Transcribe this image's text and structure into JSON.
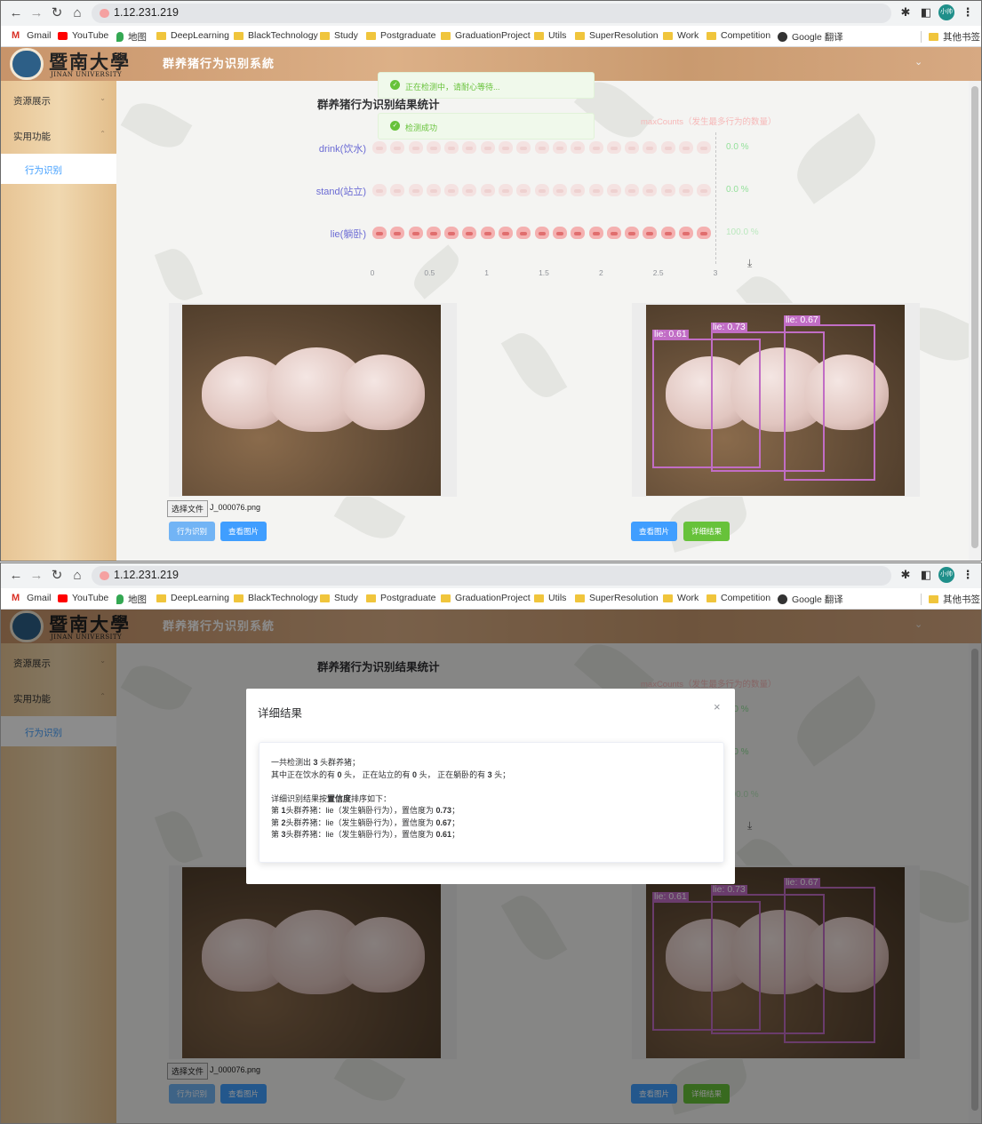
{
  "browser": {
    "url": "1.12.231.219",
    "avatar_text": "小帅",
    "bookmarks": [
      "Gmail",
      "YouTube",
      "地图",
      "DeepLearning",
      "BlackTechnology",
      "Study",
      "Postgraduate",
      "GraduationProject",
      "Utils",
      "SuperResolution",
      "Work",
      "Competition",
      "Google 翻译"
    ],
    "other_bookmarks": "其他书签"
  },
  "header": {
    "logo_cn": "暨南大學",
    "logo_en": "JINAN UNIVERSITY",
    "system_title": "群养猪行为识别系統"
  },
  "sidebar": {
    "items": [
      {
        "label": "资源展示"
      },
      {
        "label": "实用功能"
      },
      {
        "label": "行为识别"
      }
    ]
  },
  "notifications": {
    "detecting": "正在检测中，请耐心等待...",
    "success": "检测成功"
  },
  "chart_data": {
    "type": "pictorial-bar",
    "title": "群养猪行为识别结果统计",
    "legend": "maxCounts（发生最多行为的数量）",
    "categories": [
      "drink(饮水)",
      "stand(站立)",
      "lie(躺卧)"
    ],
    "values": [
      0,
      0,
      3
    ],
    "percent_labels": [
      "0.0 %",
      "0.0 %",
      "100.0 %"
    ],
    "max": 3,
    "x_ticks": [
      "0",
      "0.5",
      "1",
      "1.5",
      "2",
      "2.5",
      "3"
    ],
    "symbol_color": "#f4b0b0"
  },
  "detections": [
    {
      "label": "lie: 0.61"
    },
    {
      "label": "lie: 0.73"
    },
    {
      "label": "lie: 0.67"
    }
  ],
  "upload": {
    "choose_file": "选择文件",
    "file_name": "J_000076.png"
  },
  "buttons": {
    "detect": "行为识别",
    "view_image_left": "查看图片",
    "view_image_right": "查看图片",
    "details": "详细结果"
  },
  "dialog": {
    "title": "详细结果",
    "summary_pre": "一共检测出 ",
    "summary_count": "3",
    "summary_post": " 头群养猪；",
    "breakdown": [
      "其中正在饮水的有 ",
      "0",
      " 头，  正在站立的有 ",
      "0",
      " 头，  正在躺卧的有 ",
      "3",
      " 头；"
    ],
    "detail_pre": "详细识别结果按",
    "detail_bold": "置信度",
    "detail_post": "排序如下：",
    "results": [
      {
        "rank": "1",
        "text": "头群养猪：lie（发生躺卧行为），置信度为 ",
        "conf": "0.73",
        "end": "；"
      },
      {
        "rank": "2",
        "text": "头群养猪：lie（发生躺卧行为），置信度为 ",
        "conf": "0.67",
        "end": "；"
      },
      {
        "rank": "3",
        "text": "头群养猪：lie（发生躺卧行为），置信度为 ",
        "conf": "0.61",
        "end": "；"
      }
    ],
    "rank_prefix": "第 "
  },
  "colors": {
    "primary": "#409eff",
    "success": "#67c23a",
    "bbox": "#c16dc5",
    "category_text": "#6b6bd4",
    "percent_text": "#93e09a"
  }
}
